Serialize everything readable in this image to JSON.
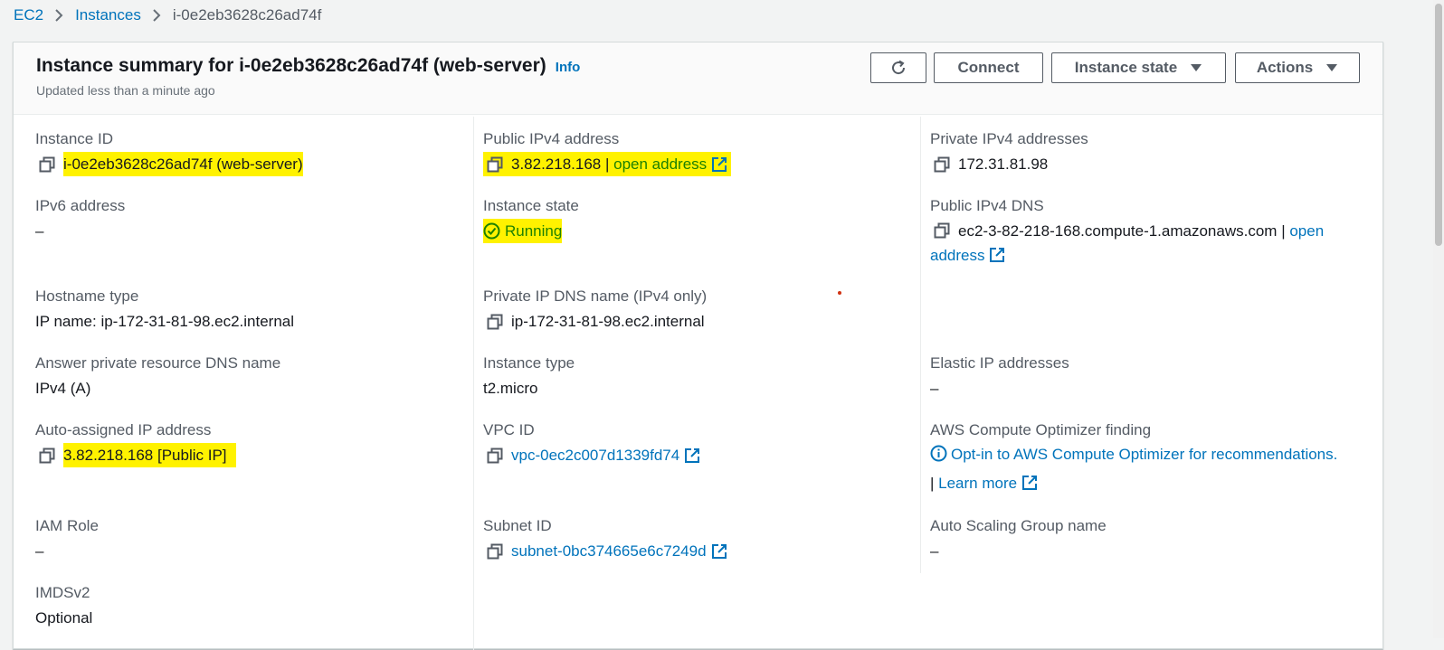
{
  "breadcrumb": {
    "root": "EC2",
    "parent": "Instances",
    "current": "i-0e2eb3628c26ad74f"
  },
  "header": {
    "title": "Instance summary for i-0e2eb3628c26ad74f (web-server)",
    "info": "Info",
    "updated": "Updated less than a minute ago",
    "buttons": {
      "connect": "Connect",
      "instance_state": "Instance state",
      "actions": "Actions"
    }
  },
  "col1": {
    "instance_id": {
      "label": "Instance ID",
      "value": "i-0e2eb3628c26ad74f (web-server)"
    },
    "ipv6": {
      "label": "IPv6 address",
      "value": "–"
    },
    "hostname_type": {
      "label": "Hostname type",
      "value": "IP name: ip-172-31-81-98.ec2.internal"
    },
    "answer_dns": {
      "label": "Answer private resource DNS name",
      "value": "IPv4 (A)"
    },
    "auto_ip": {
      "label": "Auto-assigned IP address",
      "value": "3.82.218.168 [Public IP]"
    },
    "iam_role": {
      "label": "IAM Role",
      "value": "–"
    },
    "imdsv2": {
      "label": "IMDSv2",
      "value": "Optional"
    }
  },
  "col2": {
    "public_ipv4": {
      "label": "Public IPv4 address",
      "ip": "3.82.218.168",
      "sep": " | ",
      "link": "open address"
    },
    "instance_state": {
      "label": "Instance state",
      "value": "Running"
    },
    "private_dns": {
      "label": "Private IP DNS name (IPv4 only)",
      "value": "ip-172-31-81-98.ec2.internal"
    },
    "instance_type": {
      "label": "Instance type",
      "value": "t2.micro"
    },
    "vpc_id": {
      "label": "VPC ID",
      "value": "vpc-0ec2c007d1339fd74"
    },
    "subnet_id": {
      "label": "Subnet ID",
      "value": "subnet-0bc374665e6c7249d"
    }
  },
  "col3": {
    "private_ipv4": {
      "label": "Private IPv4 addresses",
      "value": "172.31.81.98"
    },
    "public_dns": {
      "label": "Public IPv4 DNS",
      "value": "ec2-3-82-218-168.compute-1.amazonaws.com",
      "sep": " | ",
      "link_1": "open",
      "link_2": "address"
    },
    "elastic_ip": {
      "label": "Elastic IP addresses",
      "value": "–"
    },
    "optimizer": {
      "label": "AWS Compute Optimizer finding",
      "link": "Opt-in to AWS Compute Optimizer for recommendations.",
      "sep": "| ",
      "learn": "Learn more"
    },
    "asg": {
      "label": "Auto Scaling Group name",
      "value": "–"
    }
  },
  "colors": {
    "link": "#0073bb",
    "running": "#1d8102",
    "highlight": "#fff200",
    "label": "#545b64"
  }
}
